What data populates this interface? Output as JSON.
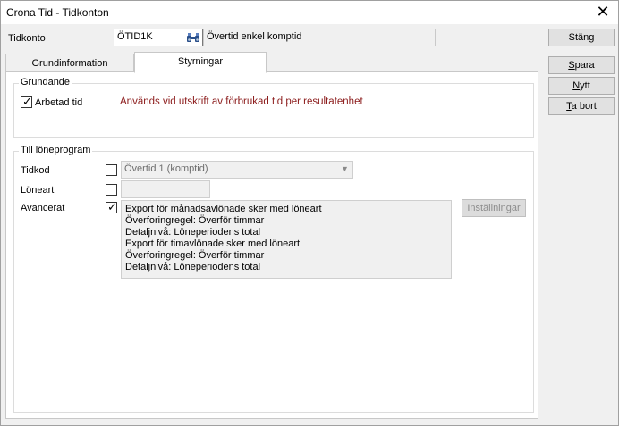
{
  "window": {
    "title": "Crona Tid - Tidkonton"
  },
  "header": {
    "tidkonto_label": "Tidkonto",
    "tidkonto_code": "ÖTID1K",
    "tidkonto_name": "Övertid enkel komptid"
  },
  "buttons": {
    "stang": "Stäng",
    "spara": "Spara",
    "nytt": "Nytt",
    "ta_bort": "Ta bort",
    "installningar": "Inställningar"
  },
  "tabs": [
    {
      "label": "Grundinformation",
      "active": false
    },
    {
      "label": "Styrningar",
      "active": true
    }
  ],
  "grundande": {
    "title": "Grundande",
    "arbetad_tid_label": "Arbetad tid",
    "arbetad_tid_checked": true,
    "hint": "Används vid utskrift av förbrukad tid per resultatenhet"
  },
  "loneprogram": {
    "title": "Till löneprogram",
    "tidkod_label": "Tidkod",
    "tidkod_checked": false,
    "tidkod_value": "Övertid 1 (komptid)",
    "loneart_label": "Löneart",
    "loneart_checked": false,
    "loneart_value": "",
    "avancerat_label": "Avancerat",
    "avancerat_checked": true,
    "avancerat_lines": [
      "Export för månadsavlönade sker med löneart",
      "Överforingregel: Överför timmar",
      "Detaljnivå: Löneperiodens total",
      "Export för timavlönade sker med löneart",
      "Överforingregel: Överför timmar",
      "Detaljnivå: Löneperiodens total"
    ]
  },
  "colors": {
    "hint_text": "#8b1a1a",
    "window_bg": "#f0f0f0"
  }
}
